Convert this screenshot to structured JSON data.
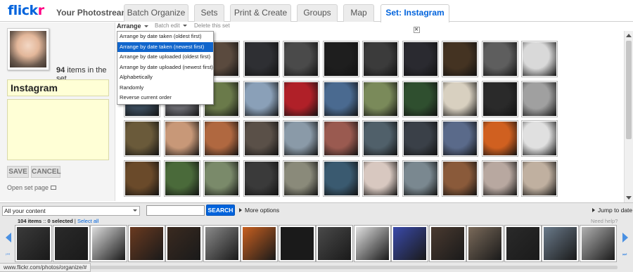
{
  "header": {
    "logo_part1": "flick",
    "logo_part2": "r",
    "app_title": "Your Photostream",
    "tabs": [
      {
        "label": "Batch Organize"
      },
      {
        "label": "Sets"
      },
      {
        "label": "Print & Create"
      },
      {
        "label": "Groups"
      },
      {
        "label": "Map"
      },
      {
        "label": "Set: Instagram",
        "active": true,
        "close_icon": "close-icon"
      }
    ]
  },
  "toolbar": {
    "arrange_label": "Arrange",
    "batch_edit_label": "Batch edit",
    "delete_set_label": "Delete this set"
  },
  "arrange_menu": {
    "items": [
      {
        "label": "Arrange by date taken (oldest first)"
      },
      {
        "label": "Arrange by date taken (newest first)",
        "selected": true
      },
      {
        "label": "Arrange by date uploaded (oldest first)"
      },
      {
        "label": "Arrange by date uploaded (newest first)"
      },
      {
        "label": "Alphabetically"
      },
      {
        "label": "Randomly"
      },
      {
        "label": "Reverse current order"
      }
    ]
  },
  "set_panel": {
    "item_count": "94",
    "item_count_suffix": " items in the set",
    "title_value": "Instagram",
    "description_value": "",
    "save_label": "SAVE",
    "cancel_label": "CANCEL",
    "open_set_label": "Open set page",
    "open_set_icon": "external-link-icon"
  },
  "bottom_bar": {
    "filter_value": "All your content",
    "search_value": "",
    "search_label": "SEARCH",
    "more_options_label": "More options",
    "jump_to_date_label": "Jump to date",
    "selection_count": "104 items",
    "selection_sep": " :: ",
    "selection_selected": "0 selected",
    "selection_pipe": " | ",
    "select_all_label": "Select all",
    "need_help_label": "Need help?",
    "tray_prev_icon": "arrow-left-icon",
    "tray_next_icon": "arrow-right-icon",
    "tray_first_icon": "skip-first-icon",
    "tray_last_icon": "skip-last-icon",
    "first_glyph": "⏮",
    "last_glyph": "⏭"
  },
  "status_bar": {
    "url": "www.flickr.com/photos/organize/#"
  },
  "colors": {
    "flickr_blue": "#0063dc",
    "flickr_pink": "#ff0084",
    "menu_selected": "#1166cc",
    "set_field_bg": "#ffffd6",
    "nav_arrow": "#4a90e2"
  },
  "grid_rows": [
    [
      "#2b2b2b",
      "#3a3a3a",
      "#5a4a3e",
      "#2e2f33",
      "#4a4a4a",
      "#1e1e1e",
      "#3b3b3b",
      "#2a2a30",
      "#443322",
      "#5e5e5e",
      "#d9d9d9"
    ],
    [
      "#3a4a5a",
      "#6a6a70",
      "#6a7a4a",
      "#8aa0b8",
      "#b02028",
      "#4a6a90",
      "#7a8a5a",
      "#2f4f2f",
      "#d8d0c0",
      "#2a2a2a",
      "#a0a0a0"
    ],
    [
      "#6a5a3a",
      "#c89878",
      "#b06840",
      "#5a5048",
      "#8a9aa8",
      "#9a5a50",
      "#50606a",
      "#3a4048",
      "#5a6a8a",
      "#d06020",
      "#e0e0e0"
    ],
    [
      "#6a4a2a",
      "#4a6a3a",
      "#7a8a6a",
      "#3a3a3a",
      "#8a8a7a",
      "#3a5a70",
      "#d8c8c0",
      "#7a8890",
      "#8a5a3a",
      "#b8a8a0",
      "#c0b0a0"
    ]
  ],
  "tray_thumbs": [
    "#3a3a3a",
    "#2a2a2a",
    "#dcdcdc",
    "#6a3a20",
    "#3a2a20",
    "#8a8a8a",
    "#c86020",
    "#1a1a1a",
    "#4a4a4a",
    "#e0e0e0",
    "#3a4aaa",
    "#4a3a30",
    "#7a6a5a",
    "#2a2a2a",
    "#6a7a8a",
    "#b0b0b0"
  ]
}
